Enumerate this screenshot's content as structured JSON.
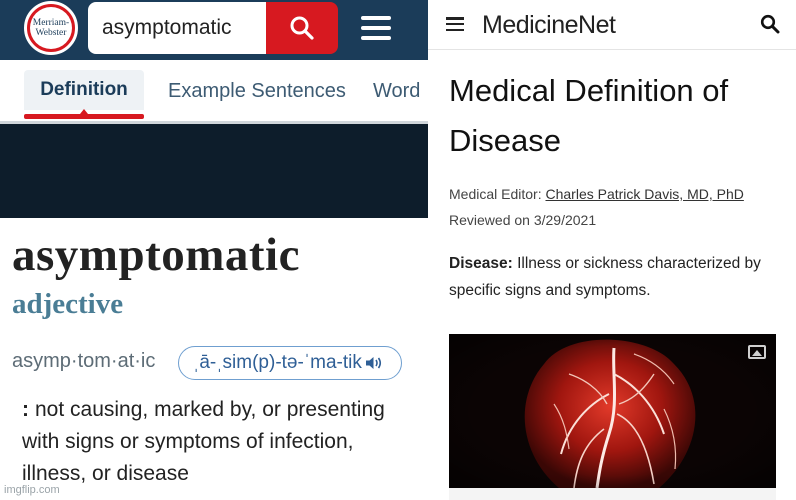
{
  "mw": {
    "logo_line1": "Merriam-",
    "logo_line2": "Webster",
    "search_value": "asymptomatic",
    "tabs": [
      "Definition",
      "Example Sentences",
      "Word"
    ],
    "headword": "asymptomatic",
    "part_of_speech": "adjective",
    "syllables": "asymp·tom·at·ic",
    "pronunciation": "ˌā-ˌsim(p)-tə-ˈma-tik",
    "definition_colon": ":",
    "definition": "not causing, marked by, or presenting with signs or symptoms of infection, illness, or disease"
  },
  "mn": {
    "brand": "MedicineNet",
    "title": "Medical Definition of Disease",
    "editor_label": "Medical Editor:",
    "editor_name": "Charles Patrick Davis, MD, PhD",
    "reviewed": "Reviewed on 3/29/2021",
    "def_term": "Disease:",
    "def_text": "Illness or sickness characterized by specific signs and symptoms."
  },
  "watermark": "imgflip.com",
  "colors": {
    "mw_header": "#1b3c59",
    "mw_red": "#d71920",
    "mw_pos_blue": "#4a7d95",
    "pron_blue": "#2f5f96"
  },
  "icons": {
    "mw_search": "search-icon",
    "mw_menu": "hamburger-menu-icon",
    "mw_audio": "speaker-icon",
    "mn_menu": "hamburger-menu-icon",
    "mn_search": "search-icon",
    "mn_image": "image-gallery-icon"
  }
}
